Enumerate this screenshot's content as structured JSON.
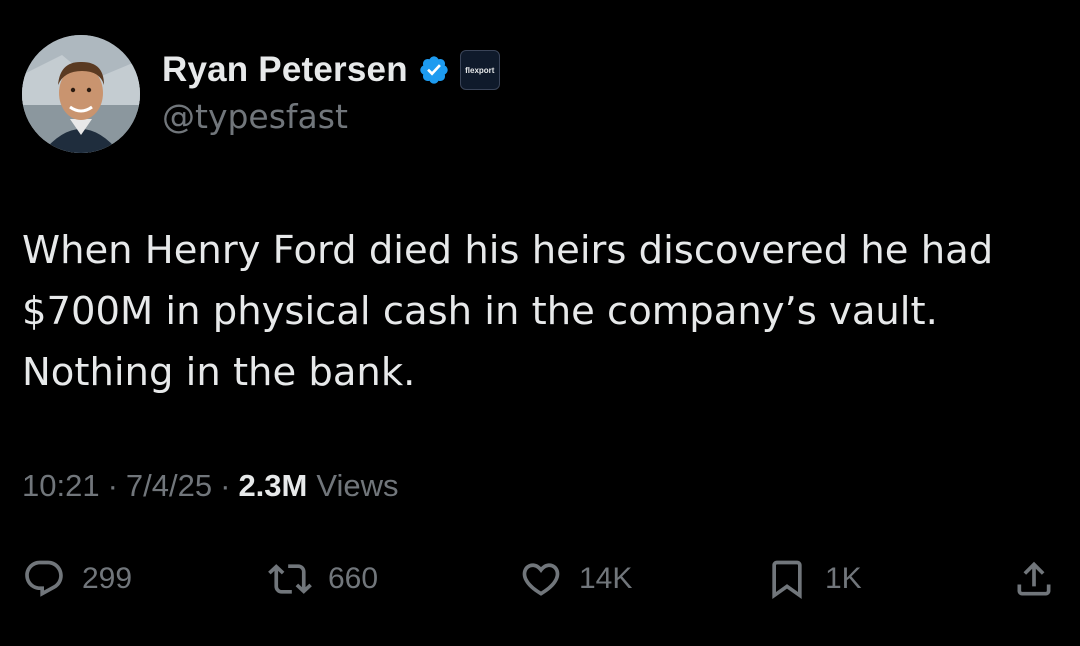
{
  "author": {
    "display_name": "Ryan Petersen",
    "handle": "@typesfast",
    "verified": true,
    "affiliate_badge_text": "flexport",
    "verified_color": "#1d9bf0"
  },
  "tweet": {
    "text": "When Henry Ford died his heirs discovered he had\n$700M in physical cash in the company’s vault.\nNothing in the bank."
  },
  "meta": {
    "time": "10:21",
    "separator": "·",
    "date": "7/4/25",
    "views_count": "2.3M",
    "views_label": "Views"
  },
  "actions": {
    "reply": {
      "icon": "reply-icon",
      "count": "299"
    },
    "repost": {
      "icon": "repost-icon",
      "count": "660"
    },
    "like": {
      "icon": "heart-icon",
      "count": "14K"
    },
    "bookmark": {
      "icon": "bookmark-icon",
      "count": "1K"
    },
    "share": {
      "icon": "share-icon"
    }
  },
  "colors": {
    "background": "#000000",
    "primary_text": "#e7e9ea",
    "secondary_text": "#71767b"
  }
}
